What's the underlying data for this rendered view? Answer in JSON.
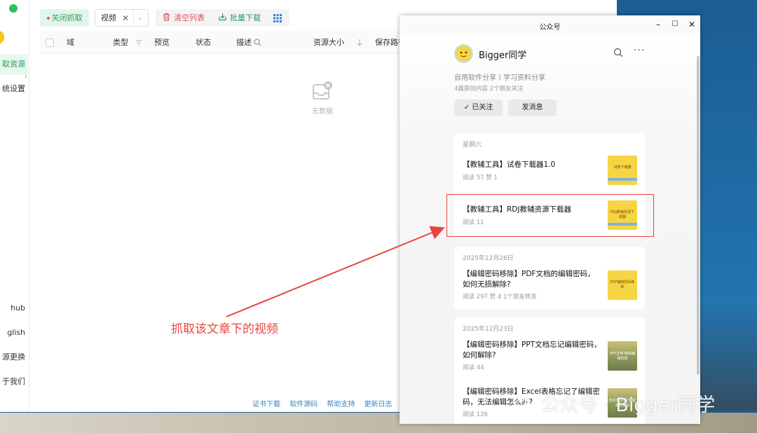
{
  "sidebar": {
    "items": [
      "取资源",
      "统设置",
      "hub",
      "glish",
      "源更换",
      "于我们"
    ]
  },
  "toolbar": {
    "stop_capture": "关闭抓取",
    "filter_tag": "视频",
    "clear_list": "清空列表",
    "batch_download": "批量下载"
  },
  "table": {
    "columns": [
      "域",
      "类型",
      "预览",
      "状态",
      "描述",
      "资源大小",
      "保存路径"
    ],
    "empty_text": "无数据"
  },
  "footer": {
    "links": [
      "证书下载",
      "软件源码",
      "帮助支持",
      "更新日志"
    ]
  },
  "annotation": {
    "note": "抓取该文章下的视频"
  },
  "wechat": {
    "window_title": "公众号",
    "account_name": "Bigger同学",
    "description": "自用软件分享丨学习资料分享",
    "stats": "4篇原创内容  2个朋友关注",
    "followed_label": "已关注",
    "message_label": "发消息",
    "groups": [
      {
        "date": "星期六",
        "articles": [
          {
            "title": "【教辅工具】试卷下载器1.0",
            "meta": "阅读 57  赞 1",
            "thumb_caption": "试卷下载器"
          },
          {
            "title": "【教辅工具】RDJ教辅资源下载器",
            "meta": "阅读 11",
            "thumb_caption": "RDJ教辅资源下载器"
          }
        ]
      },
      {
        "date": "2025年12月26日",
        "articles": [
          {
            "title": "【编辑密码移除】PDF文档的编辑密码，如何无损解除?",
            "meta": "阅读 297  赞 4  1个朋友转发",
            "thumb_caption": "PDF编辑密码移除"
          }
        ]
      },
      {
        "date": "2025年12月23日",
        "articles": [
          {
            "title": "【编辑密码移除】PPT文档忘记编辑密码，如何解除?",
            "meta": "阅读 44",
            "thumb_caption": "PPT文档 移除编辑密码"
          },
          {
            "title": "【编辑密码移除】Excel表格忘记了编辑密码，无法编辑怎么办?",
            "meta": "阅读 126",
            "thumb_caption": "EXCEL文档 移除编辑密码"
          }
        ]
      }
    ]
  },
  "watermark": {
    "text": "公众号 · Bigger同学"
  },
  "colors": {
    "accent_green": "#2a9d5f",
    "danger_red": "#e0525a",
    "annotation_red": "#e8453c",
    "link_blue": "#3b86c7"
  }
}
